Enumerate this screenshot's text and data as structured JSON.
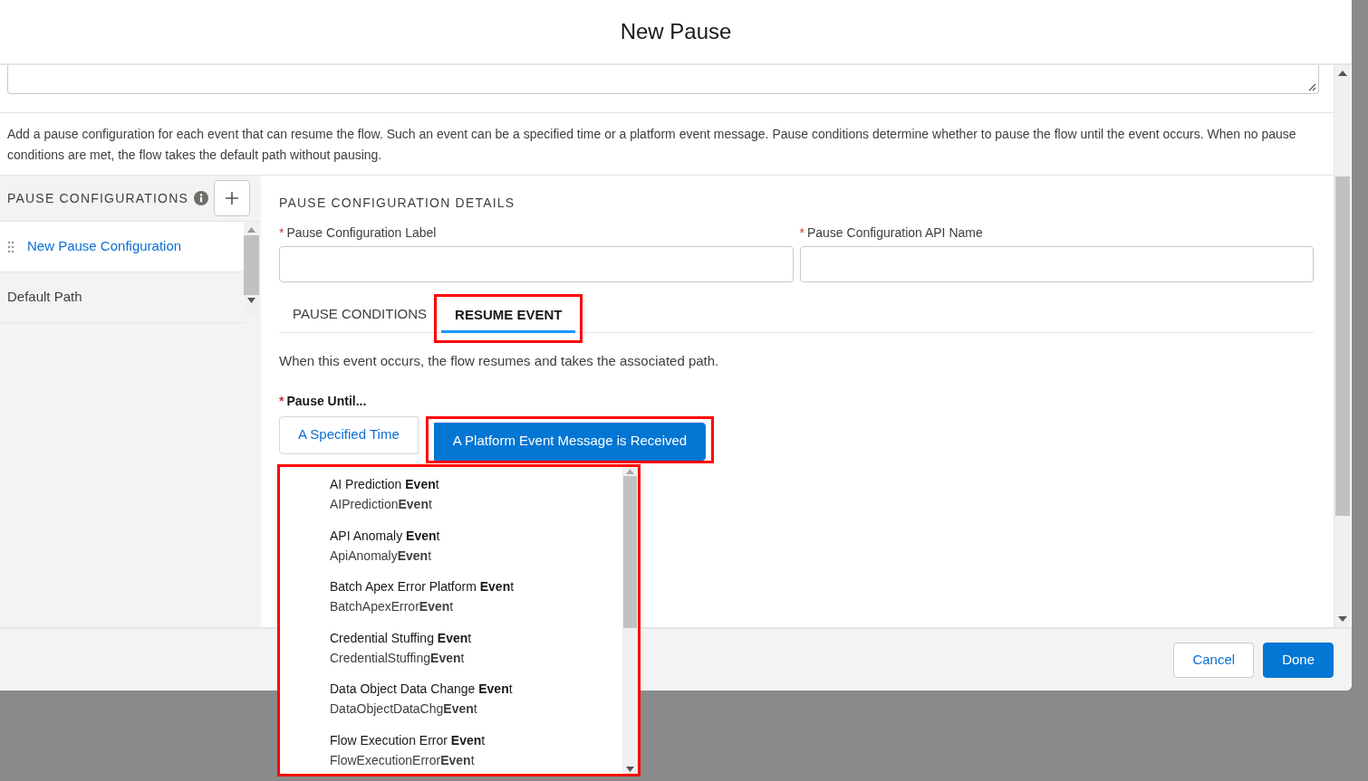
{
  "window": {
    "title": "New Pause"
  },
  "required_marker": "*",
  "description": "Add a pause configuration for each event that can resume the flow. Such an event can be a specified time or a platform event message. Pause conditions determine whether to pause the flow until the event occurs. When no pause conditions are met, the flow takes the default path without pausing.",
  "sidebar": {
    "heading": "PAUSE CONFIGURATIONS",
    "items": [
      {
        "label": "New Pause Configuration",
        "selected": true
      },
      {
        "label": "Default Path",
        "selected": false
      }
    ]
  },
  "details": {
    "heading": "PAUSE CONFIGURATION DETAILS",
    "fields": [
      {
        "label": "Pause Configuration Label",
        "required": true
      },
      {
        "label": "Pause Configuration API Name",
        "required": true
      }
    ],
    "tabs": [
      {
        "label": "PAUSE CONDITIONS",
        "selected": false,
        "highlighted": false
      },
      {
        "label": "RESUME EVENT",
        "selected": true,
        "highlighted": true
      }
    ],
    "tab_text": "When this event occurs, the flow resumes and takes the associated path.",
    "pause_until": {
      "label": "Pause Until...",
      "required": true,
      "options": [
        {
          "label": "A Specified Time",
          "selected": false,
          "highlighted": false
        },
        {
          "label": "A Platform Event Message is Received",
          "selected": true,
          "highlighted": true
        }
      ]
    }
  },
  "dropdown": {
    "highlighted": true,
    "options": [
      {
        "label": "AI Prediction **Even**t",
        "api_name": "AIPrediction**Even**t"
      },
      {
        "label": "API Anomaly **Even**t",
        "api_name": "ApiAnomaly**Even**t"
      },
      {
        "label": "Batch Apex Error Platform **Even**t",
        "api_name": "BatchApexError**Even**t"
      },
      {
        "label": "Credential Stuffing **Even**t",
        "api_name": "CredentialStuffing**Even**t"
      },
      {
        "label": "Data Object Data Change **Even**t",
        "api_name": "DataObjectDataChg**Even**t"
      },
      {
        "label": "Flow Execution Error **Even**t",
        "api_name": "FlowExecutionError**Even**t"
      }
    ]
  },
  "footer": {
    "buttons": [
      {
        "label": "Cancel",
        "kind": "neutral"
      },
      {
        "label": "Done",
        "kind": "brand"
      }
    ]
  }
}
